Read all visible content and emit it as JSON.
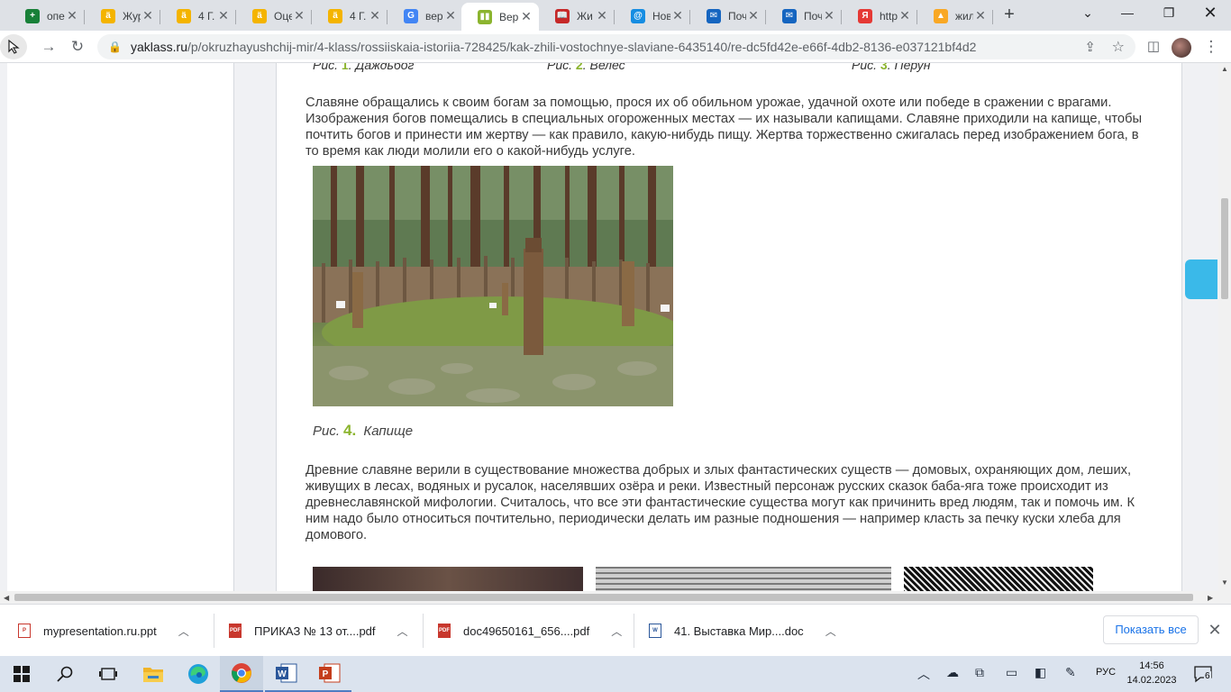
{
  "browser": {
    "tabs": [
      {
        "title": "опе",
        "favicon": "sheets-icon",
        "color": "#188038",
        "glyph": "+"
      },
      {
        "title": "Жур",
        "favicon": "pear-icon",
        "color": "#f4b400",
        "glyph": "ä"
      },
      {
        "title": "4 Г.",
        "favicon": "pear-icon",
        "color": "#f4b400",
        "glyph": "ä"
      },
      {
        "title": "Оце",
        "favicon": "pear-icon",
        "color": "#f4b400",
        "glyph": "ä"
      },
      {
        "title": "4 Г.",
        "favicon": "pear-icon",
        "color": "#f4b400",
        "glyph": "ä"
      },
      {
        "title": "вер",
        "favicon": "google-icon",
        "color": "#4285f4",
        "glyph": "G"
      },
      {
        "title": "Вер",
        "favicon": "yaklass-icon",
        "color": "#8bb42e",
        "glyph": "▮▮",
        "active": true
      },
      {
        "title": "Жи",
        "favicon": "book-icon",
        "color": "#c62828",
        "glyph": "📖"
      },
      {
        "title": "Нов",
        "favicon": "mail-ru-icon",
        "color": "#168de2",
        "glyph": "@"
      },
      {
        "title": "Поч",
        "favicon": "outlook-icon",
        "color": "#1565c0",
        "glyph": "✉"
      },
      {
        "title": "Поч",
        "favicon": "outlook-icon",
        "color": "#1565c0",
        "glyph": "✉"
      },
      {
        "title": "http",
        "favicon": "yandex-icon",
        "color": "#e53935",
        "glyph": "Я"
      },
      {
        "title": "жил",
        "favicon": "image-icon",
        "color": "#f9a825",
        "glyph": "▲"
      }
    ],
    "url_host": "yaklass.ru",
    "url_path": "/p/okruzhayushchij-mir/4-klass/rossiiskaia-istoriia-728425/kak-zhili-vostochnye-slaviane-6435140/re-dc5fd42e-e66f-4db2-8136-e037121bf4d2"
  },
  "article": {
    "top_captions": [
      {
        "prefix": "Рис.",
        "num": "1",
        "name": "Даждьбог"
      },
      {
        "prefix": "Рис.",
        "num": "2",
        "name": "Велес"
      },
      {
        "prefix": "Рис.",
        "num": "3",
        "name": "Перун"
      }
    ],
    "paragraph1": "Славяне обращались к своим богам за помощью, прося их об обильном урожае, удачной охоте или победе в сражении с врагами. Изображения богов помещались в специальных огороженных местах — их называли капищами. Славяне приходили на капище, чтобы почтить богов и принести им жертву — как правило, какую-нибудь пищу. Жертва торжественно сжигалась перед изображением бога, в то время как люди молили его о какой-нибудь услуге.",
    "figure4": {
      "prefix": "Рис.",
      "num": "4.",
      "name": "Капище"
    },
    "paragraph2": "Древние славяне верили в существование множества добрых и злых фантастических существ — домовых, охраняющих дом, леших, живущих в лесах, водяных и русалок, населявших озёра и реки. Известный персонаж русских сказок баба-яга тоже происходит из древнеславянской мифологии. Считалось, что все эти фантастические существа могут как причинить вред людям, так и помочь им. К ним надо было относиться почтительно, периодически делать им разные подношения — например класть за печку куски хлеба для домового."
  },
  "downloads": {
    "items": [
      {
        "name": "mypresentation.ru.ppt",
        "type": "ppt",
        "tag": "P"
      },
      {
        "name": "ПРИКАЗ № 13 от....pdf",
        "type": "pdf",
        "tag": "PDF"
      },
      {
        "name": "doc49650161_656....pdf",
        "type": "pdf",
        "tag": "PDF"
      },
      {
        "name": "41. Выставка Мир....doc",
        "type": "doc",
        "tag": "W"
      }
    ],
    "show_all": "Показать все"
  },
  "taskbar": {
    "lang": "РУС",
    "time": "14:56",
    "date": "14.02.2023",
    "notifications": "6"
  },
  "colors": {
    "accent_green": "#8bb42e",
    "side_button": "#3ab9e9",
    "link_blue": "#1a73e8"
  }
}
